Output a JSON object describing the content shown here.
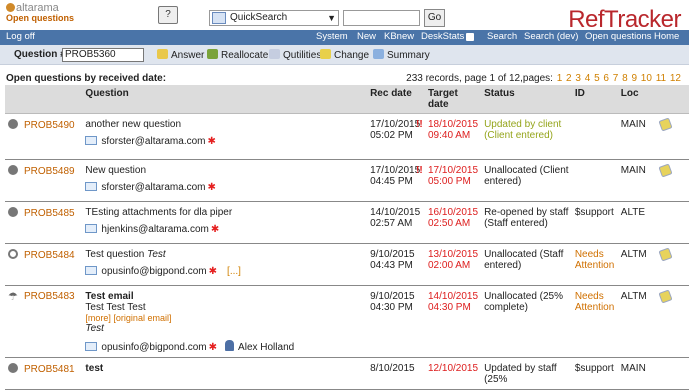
{
  "header": {
    "brand": "altarama",
    "subtitle": "Open questions",
    "help_icon": "?",
    "quicksearch_selected": "QuickSearch",
    "quicksearch_value": "",
    "go_label": "Go",
    "app_title": "RefTracker"
  },
  "nav": {
    "logoff": "Log off",
    "items": [
      "System",
      "New",
      "KBnew",
      "DeskStats",
      "Search",
      "Search (dev)",
      "Open questions",
      "Home"
    ]
  },
  "toolbar": {
    "question_label": "Question #",
    "question_value": "PROB5360",
    "answer": "Answer",
    "reallocate": "Reallocate",
    "qutilities": "Qutilities",
    "change": "Change",
    "summary": "Summary"
  },
  "list": {
    "heading": "Open questions by received date:",
    "paging_text": "233 records, page 1 of 12,pages:",
    "pages": [
      "1",
      "2",
      "3",
      "4",
      "5",
      "6",
      "7",
      "8",
      "9",
      "10",
      "11",
      "12"
    ]
  },
  "table": {
    "headers": [
      "Question",
      "Rec date",
      "Target date",
      "Status",
      "ID",
      "Loc"
    ],
    "rows": [
      {
        "id": "PROB5490",
        "question": "another new question",
        "email": "sforster@altarama.com",
        "rec_date": "17/10/2015",
        "rec_time": "05:02 PM",
        "urgent": "!!",
        "target_date": "18/10/2015",
        "target_time": "09:40 AM",
        "status": "Updated by client (Client entered)",
        "status_color": "green",
        "user_id": "",
        "loc": "MAIN"
      },
      {
        "id": "PROB5489",
        "question": "New question",
        "email": "sforster@altarama.com",
        "rec_date": "17/10/2015",
        "rec_time": "04:45 PM",
        "urgent": "!!",
        "target_date": "17/10/2015",
        "target_time": "05:00 PM",
        "status": "Unallocated (Client entered)",
        "status_color": "normal",
        "user_id": "",
        "loc": "MAIN"
      },
      {
        "id": "PROB5485",
        "question": "TEsting attachments for dla piper",
        "email": "hjenkins@altarama.com",
        "rec_date": "14/10/2015",
        "rec_time": "02:57 AM",
        "urgent": "",
        "target_date": "16/10/2015",
        "target_time": "02:50 AM",
        "status": "Re-opened by staff (Staff entered)",
        "status_color": "normal",
        "user_id": "$support",
        "loc": "ALTE"
      },
      {
        "id": "PROB5484",
        "question": "Test question",
        "question_extra": "Test",
        "email": "opusinfo@bigpond.com",
        "ellipsis": "[...]",
        "rec_date": "9/10/2015",
        "rec_time": "04:43 PM",
        "urgent": "",
        "target_date": "13/10/2015",
        "target_time": "02:00 AM",
        "status": "Unallocated (Staff entered)",
        "status_color": "normal",
        "user_id": "Needs Attention",
        "loc": "ALTM"
      },
      {
        "id": "PROB5483",
        "question": "Test email",
        "line2": "Test Test Test",
        "links": "[more] [original email]",
        "line3": "Test",
        "email": "opusinfo@bigpond.com",
        "assignee": "Alex Holland",
        "rec_date": "9/10/2015",
        "rec_time": "04:30 PM",
        "urgent": "",
        "target_date": "14/10/2015",
        "target_time": "04:30 PM",
        "status": "Unallocated (25% complete)",
        "status_color": "normal",
        "user_id": "Needs Attention",
        "loc": "ALTM"
      },
      {
        "id": "PROB5481",
        "question": "test",
        "rec_date": "8/10/2015",
        "target_date": "12/10/2015",
        "status": "Updated by staff (25%",
        "user_id": "$support",
        "loc": "MAIN"
      }
    ]
  }
}
